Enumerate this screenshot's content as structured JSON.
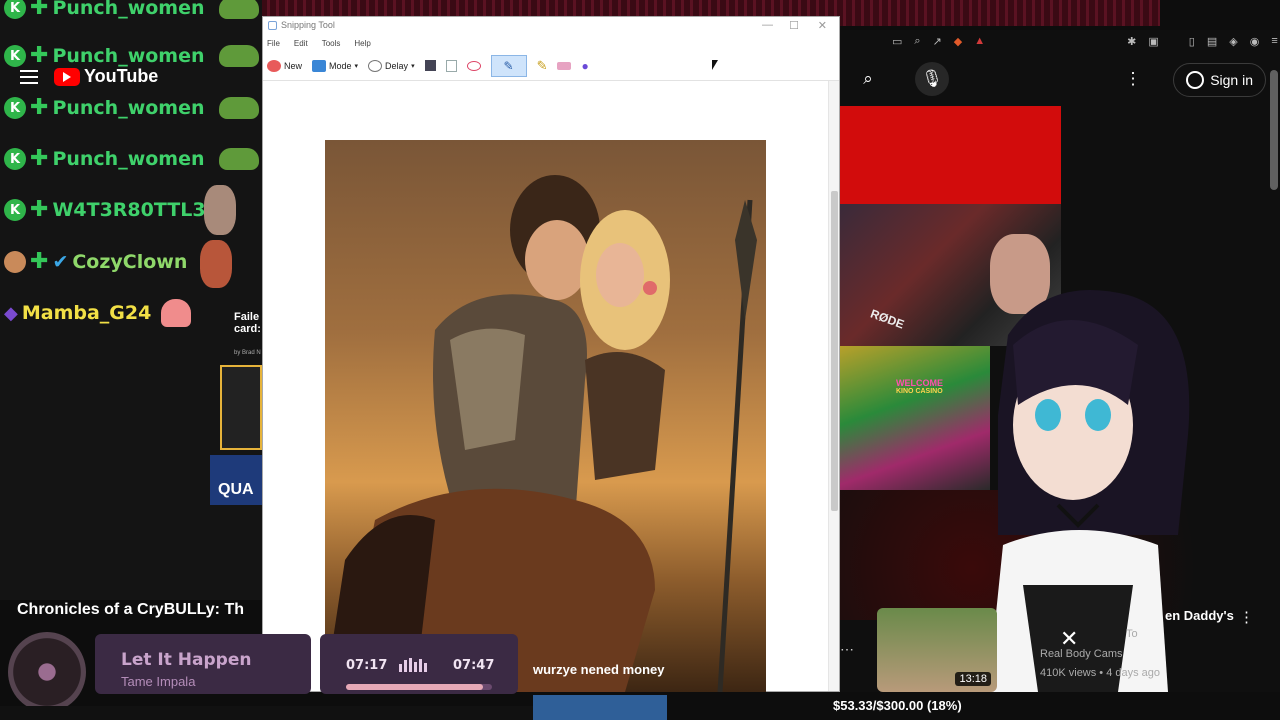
{
  "chat": {
    "messages": [
      {
        "user": "Punch_women",
        "color": "#3fd16b"
      },
      {
        "user": "Punch_women",
        "color": "#3fd16b"
      },
      {
        "user": "Punch_women",
        "color": "#3fd16b"
      },
      {
        "user": "Punch_women",
        "color": "#3fd16b"
      },
      {
        "user": "W4T3R80TTL3",
        "color": "#3fd16b"
      },
      {
        "user": "CozyClown",
        "color": "#8fd86a"
      },
      {
        "user": "Mamba_G24",
        "color": "#f2e046"
      }
    ],
    "k_badge": "K"
  },
  "youtube_small": {
    "brand": "YouTube"
  },
  "left_panel": {
    "faile_text": "Faile card:",
    "by_text": "by Brad N",
    "qua_text": "QUA"
  },
  "caption": {
    "title": "Chronicles of a CryBULLy: Th"
  },
  "snipping_tool": {
    "title": "Snipping Tool",
    "menu": [
      "File",
      "Edit",
      "Tools",
      "Help"
    ],
    "new_label": "New",
    "mode_label": "Mode",
    "delay_label": "Delay"
  },
  "youtube": {
    "sign_in": "Sign in",
    "video_title": "en Daddy's",
    "channel": "Real Body Cams",
    "views": "410K views • 4 days ago",
    "duration": "13:18",
    "to_text": "To",
    "welcome_sign": "WELCOME",
    "casino_sign": "KINO CASINO",
    "rode_label": "RØDE"
  },
  "spotify": {
    "song": "Let It Happen",
    "artist": "Tame Impala"
  },
  "timer": {
    "elapsed": "07:17",
    "total": "07:47",
    "progress": 0.94
  },
  "chat_overlay_msg": "wurzye nened money",
  "donation": {
    "text": "$53.33/$300.00 (18%)",
    "progress": 0.18
  }
}
